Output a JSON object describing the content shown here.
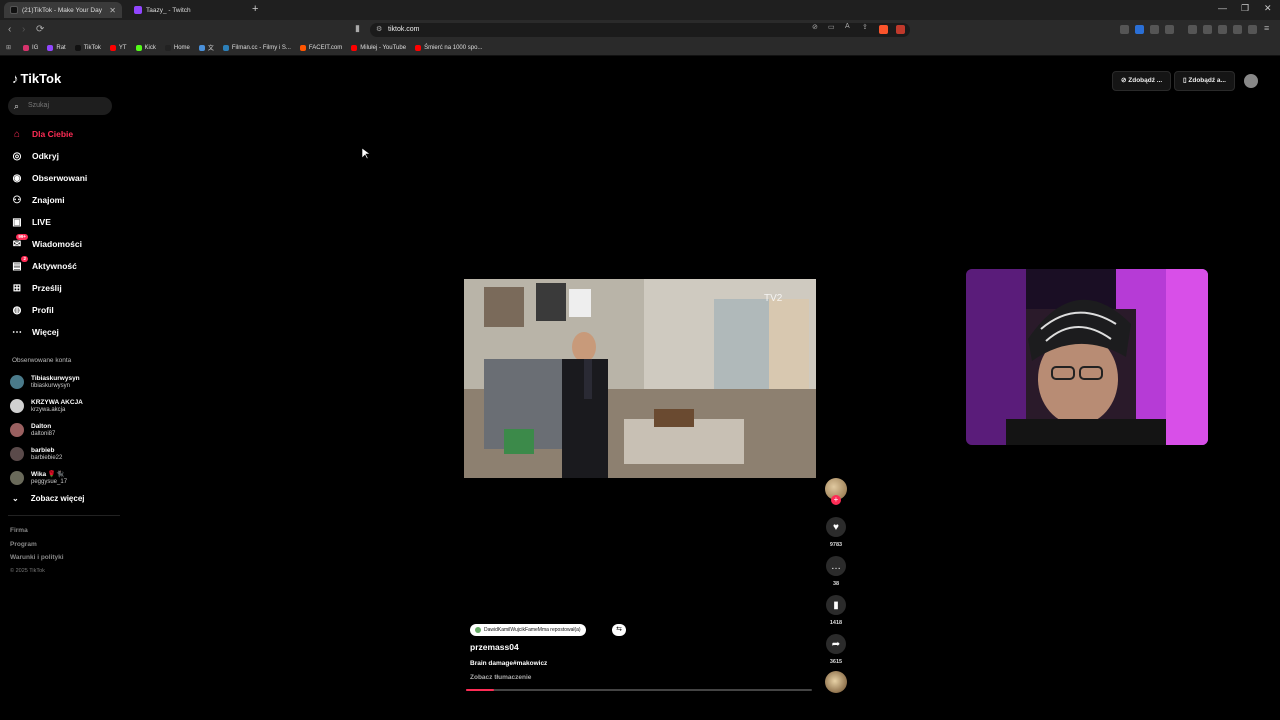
{
  "browser": {
    "tabs": [
      {
        "title": "(21)TikTok - Make Your Day",
        "active": true
      },
      {
        "title": "Taazy_ - Twitch",
        "active": false
      }
    ],
    "url": "tiktok.com",
    "bookmarks": [
      {
        "label": "IG",
        "color": "#d6336c"
      },
      {
        "label": "Rat",
        "color": "#9146ff"
      },
      {
        "label": "TikTok",
        "color": "#111111"
      },
      {
        "label": "YT",
        "color": "#ff0000"
      },
      {
        "label": "Kick",
        "color": "#53fc18"
      },
      {
        "label": "Home",
        "color": "#222222"
      },
      {
        "label": "文",
        "color": "#4a90d9"
      },
      {
        "label": "Filman.cc - Filmy i S...",
        "color": "#2c7fb8"
      },
      {
        "label": "FACEIT.com",
        "color": "#ff5500"
      },
      {
        "label": "Milułej - YouTube",
        "color": "#ff0000"
      },
      {
        "label": "Śmierć na 1000 spo...",
        "color": "#ff0000"
      }
    ]
  },
  "tiktok": {
    "logo": "TikTok",
    "search_placeholder": "Szukaj",
    "nav": [
      {
        "label": "Dla Ciebie",
        "icon": "home-icon",
        "active": true
      },
      {
        "label": "Odkryj",
        "icon": "compass-icon"
      },
      {
        "label": "Obserwowani",
        "icon": "following-icon"
      },
      {
        "label": "Znajomi",
        "icon": "friends-icon"
      },
      {
        "label": "LIVE",
        "icon": "live-icon"
      },
      {
        "label": "Wiadomości",
        "icon": "messages-icon",
        "badge": "99+"
      },
      {
        "label": "Aktywność",
        "icon": "activity-icon",
        "badge": "2"
      },
      {
        "label": "Prześlij",
        "icon": "upload-icon"
      },
      {
        "label": "Profil",
        "icon": "profile-icon"
      },
      {
        "label": "Więcej",
        "icon": "more-icon"
      }
    ],
    "followed_title": "Obserwowane konta",
    "followed": [
      {
        "name": "Tibiaskurwysyn",
        "user": "tibiaskurwysyn",
        "color": "#4a7a8a"
      },
      {
        "name": "KRZYWA AKCJA",
        "user": "krzywa.akcja",
        "color": "#d0d0d0"
      },
      {
        "name": "Dalton",
        "user": "daltoni87",
        "color": "#9a6060"
      },
      {
        "name": "barbieb",
        "user": "barbiebie22",
        "color": "#5a4a4a"
      },
      {
        "name": "Wika 🌹🐈‍⬛",
        "user": "peggysue_17",
        "color": "#6a6a5a"
      }
    ],
    "see_more": "Zobacz więcej",
    "footer": [
      "Firma",
      "Program",
      "Warunki i polityki"
    ],
    "copyright": "© 2025 TikTok",
    "top_buttons": [
      "Zdobądź ...",
      "Zdobądź a..."
    ],
    "video": {
      "repost_text": "DawidKamilWujcikFameMma repostował(a)",
      "author": "przemass04",
      "description": "Brain damage#makowicz",
      "translate": "Zobacz tłumaczenie",
      "progress": 0.08,
      "likes": "9783",
      "comments": "38",
      "saves": "1418",
      "shares": "3615"
    }
  },
  "colors": {
    "accent": "#fe2c55",
    "background": "#000000"
  }
}
